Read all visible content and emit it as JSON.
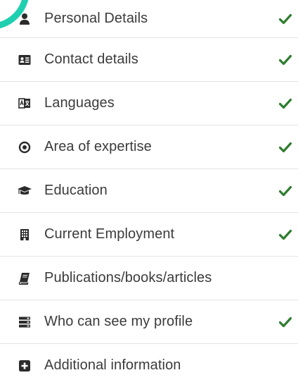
{
  "colors": {
    "accent": "#1ecfb0",
    "check": "#2e7d2e",
    "icon": "#2b2b2b",
    "text": "#3b3b3b",
    "divider": "#e3e3e3"
  },
  "menu": {
    "items": [
      {
        "label": "Personal Details",
        "icon": "user-icon",
        "completed": true
      },
      {
        "label": "Contact details",
        "icon": "address-card-icon",
        "completed": true
      },
      {
        "label": "Languages",
        "icon": "language-icon",
        "completed": true
      },
      {
        "label": "Area of expertise",
        "icon": "target-icon",
        "completed": true
      },
      {
        "label": "Education",
        "icon": "graduation-cap-icon",
        "completed": true
      },
      {
        "label": "Current Employment",
        "icon": "building-icon",
        "completed": true
      },
      {
        "label": "Publications/books/articles",
        "icon": "book-icon",
        "completed": false
      },
      {
        "label": "Who can see my profile",
        "icon": "server-list-icon",
        "completed": true
      },
      {
        "label": "Additional information",
        "icon": "plus-square-icon",
        "completed": false
      }
    ]
  }
}
